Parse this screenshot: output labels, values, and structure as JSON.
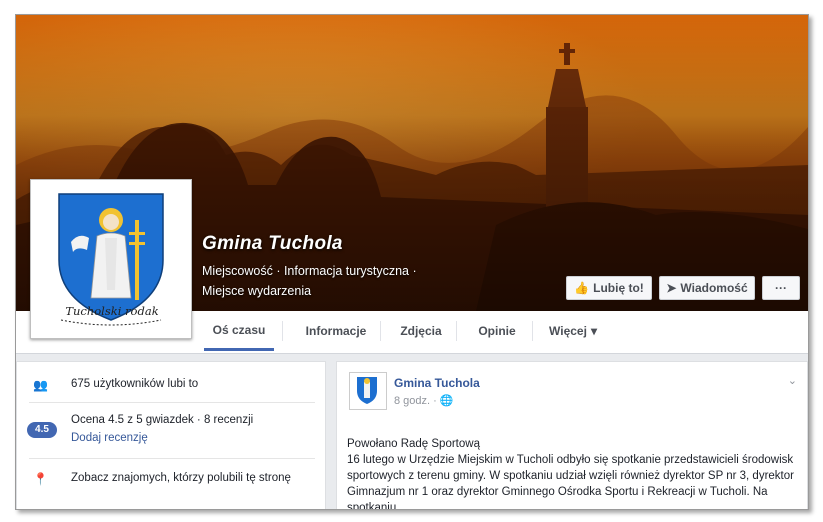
{
  "page": {
    "name": "Gmina Tuchola",
    "subtitle_line1": "Miejscowość · Informacja turystyczna ·",
    "subtitle_line2": "Miejsce wydarzenia"
  },
  "profile": {
    "crest_motto": "Tucholski rodak"
  },
  "cover_buttons": {
    "like_icon": "thumbs-up-icon",
    "like_label": "Lubię to!",
    "message_icon": "message-icon",
    "message_label": "Wiadomość",
    "more_label": "···"
  },
  "tabs": [
    {
      "label": "Oś czasu",
      "active": true
    },
    {
      "label": "Informacje",
      "active": false
    },
    {
      "label": "Zdjęcia",
      "active": false
    },
    {
      "label": "Opinie",
      "active": false
    },
    {
      "label": "Więcej",
      "active": false
    }
  ],
  "tab_more_chevron": "▾",
  "left_panel": {
    "items": [
      {
        "icon": "people-icon",
        "text": "675 użytkowników lubi to"
      },
      {
        "icon": "rating-badge",
        "badge": "4.5",
        "line1": "Ocena 4.5 z 5 gwiazdek · 8 recenzji",
        "line2": "Dodaj recenzję"
      },
      {
        "icon": "pin-icon",
        "text": "Zobacz znajomych, którzy polubili tę stronę"
      }
    ]
  },
  "post": {
    "author": "Gmina Tuchola",
    "meta": "8 godz. · ",
    "globe_icon": "globe-icon",
    "chevron": "⌄",
    "title": "Powołano Radę Sportową",
    "body": "16 lutego w Urzędzie Miejskim w Tucholi odbyło się spotkanie przedstawicieli środowisk sportowych z terenu gminy. W spotkaniu udział wzięli również dyrektor SP nr 3, dyrektor Gimnazjum nr 1 oraz dyrektor Gminnego Ośrodka Sportu i Rekreacji w Tucholi. Na spotkaniu"
  },
  "colors": {
    "accent": "#4267b2",
    "link": "#365899",
    "cover_top": "#d4650a",
    "crest_blue": "#1d6fd0"
  }
}
